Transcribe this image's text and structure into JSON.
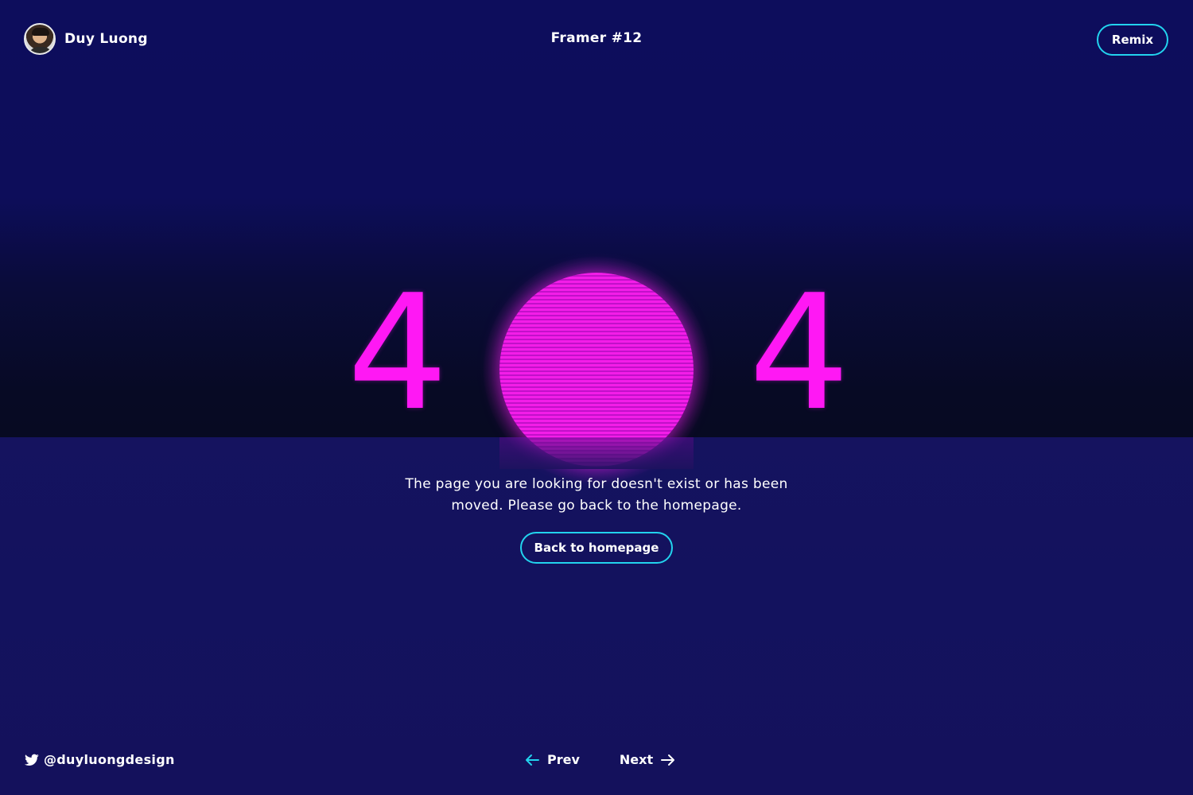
{
  "header": {
    "author_name": "Duy Luong",
    "page_title": "Framer #12",
    "remix_label": "Remix"
  },
  "hero": {
    "digit_left": "4",
    "digit_right": "4",
    "message": "The page you are looking for doesn't exist or has been moved. Please go back to the homepage.",
    "back_label": "Back to homepage"
  },
  "footer": {
    "twitter_handle": "@duyluongdesign",
    "prev_label": "Prev",
    "next_label": "Next"
  },
  "icons": {
    "twitter": "twitter-bird-icon",
    "prev": "arrow-left-icon",
    "next": "arrow-right-icon"
  },
  "colors": {
    "background": "#0f0f5a",
    "accent_magenta": "#ff18f4",
    "accent_cyan": "#22d3ee",
    "text": "#ffffff"
  }
}
